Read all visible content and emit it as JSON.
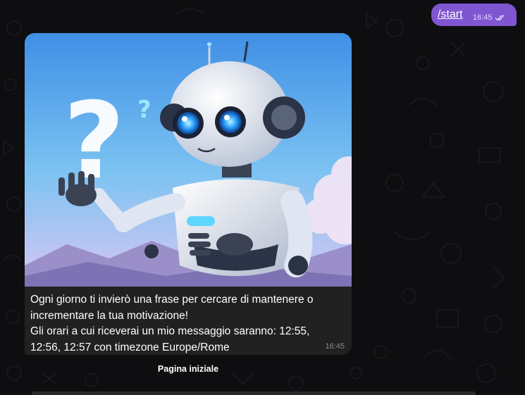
{
  "chat": {
    "outgoing": {
      "text": "/start",
      "time": "16:45",
      "status_icon": "double-check-icon"
    },
    "incoming": {
      "image": "robot-with-question-mark-illustration",
      "caption_lines": [
        "Ogni giorno ti invierò una frase per cercare di mantenere o",
        "incrementare la tua motivazione!",
        "Gli orari a cui riceverai un mio messaggio saranno: 12:55,",
        "12:56, 12:57 con timezone Europe/Rome"
      ],
      "time": "16:45"
    },
    "inline_button": {
      "label": "Pagina iniziale"
    }
  },
  "colors": {
    "background": "#0e0e10",
    "outgoing_bubble": "#7f55d1",
    "incoming_bubble": "#212121",
    "sky_top": "#3f8fe6",
    "sky_bottom": "#d9c6f2"
  }
}
